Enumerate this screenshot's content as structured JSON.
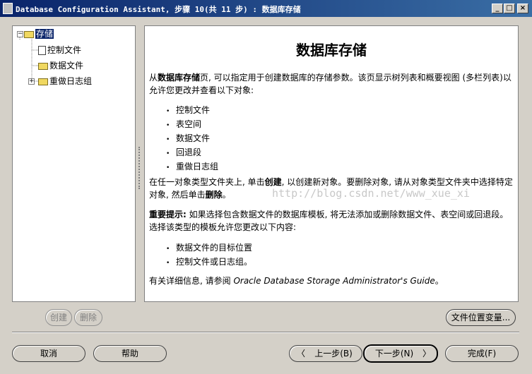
{
  "window": {
    "title": "Database Configuration Assistant, 步骤 10(共 11 步) : 数据库存储",
    "minimize": "_",
    "maximize": "□",
    "close": "×"
  },
  "tree": {
    "root": "存储",
    "items": [
      "控制文件",
      "数据文件",
      "重做日志组"
    ],
    "collapse_glyph": "−",
    "expand_glyph": "+"
  },
  "content": {
    "heading": "数据库存储",
    "intro_pre": "从",
    "intro_bold": "数据库存储",
    "intro_post": "页, 可以指定用于创建数据库的存储参数。该页显示树列表和概要视图 (多栏列表)以允许您更改并查看以下对象:",
    "objects": [
      "控制文件",
      "表空间",
      "数据文件",
      "回退段",
      "重做日志组"
    ],
    "create_pre": "在任一对象类型文件夹上, 单击",
    "create_bold": "创建",
    "create_mid": ", 以创建新对象。要删除对象, 请从对象类型文件夹中选择特定对象, 然后单击",
    "create_bold2": "删除",
    "create_post": "。",
    "note_bold": "重要提示:",
    "note_text": " 如果选择包含数据文件的数据库模板, 将无法添加或删除数据文件、表空间或回退段。选择该类型的模板允许您更改以下内容:",
    "changeable": [
      "数据文件的目标位置",
      "控制文件或日志组。"
    ],
    "more_pre": "有关详细信息, 请参阅 ",
    "more_italic": "Oracle Database Storage Administrator's Guide",
    "more_post": "。",
    "watermark": "http://blog.csdn.net/www_xue_xi"
  },
  "buttons": {
    "create": "创建",
    "delete": "删除",
    "file_location_vars": "文件位置变量...",
    "cancel": "取消",
    "help": "帮助",
    "back": "上一步(B)",
    "next": "下一步(N)",
    "finish": "完成(F)",
    "back_arrow": "〈",
    "next_arrow": "〉"
  }
}
